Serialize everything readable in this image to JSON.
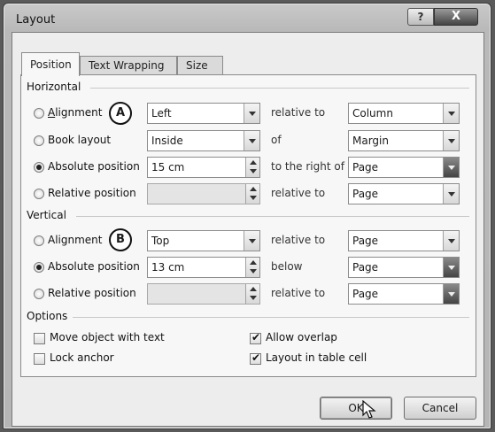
{
  "window": {
    "title": "Layout",
    "help_glyph": "?",
    "close_glyph": "X"
  },
  "tabs": [
    {
      "label": "Position",
      "active": true
    },
    {
      "label": "Text Wrapping",
      "active": false
    },
    {
      "label": "Size",
      "active": false
    }
  ],
  "horizontal": {
    "group_label": "Horizontal",
    "badge": "A",
    "rows": [
      {
        "radio_label": "Alignment",
        "selected": false,
        "value": "Left",
        "relation": "relative to",
        "target": "Column"
      },
      {
        "radio_label": "Book layout",
        "selected": false,
        "value": "Inside",
        "relation": "of",
        "target": "Margin"
      },
      {
        "radio_label": "Absolute position",
        "selected": true,
        "value": "15 cm",
        "relation": "to the right of",
        "target": "Page"
      },
      {
        "radio_label": "Relative position",
        "selected": false,
        "value": "",
        "relation": "relative to",
        "target": "Page"
      }
    ]
  },
  "vertical": {
    "group_label": "Vertical",
    "badge": "B",
    "rows": [
      {
        "radio_label": "Alignment",
        "selected": false,
        "value": "Top",
        "relation": "relative to",
        "target": "Page"
      },
      {
        "radio_label": "Absolute position",
        "selected": true,
        "value": "13 cm",
        "relation": "below",
        "target": "Page"
      },
      {
        "radio_label": "Relative position",
        "selected": false,
        "value": "",
        "relation": "relative to",
        "target": "Page"
      }
    ]
  },
  "options": {
    "group_label": "Options",
    "checkboxes": [
      {
        "label": "Move object with text",
        "checked": false
      },
      {
        "label": "Lock anchor",
        "checked": false
      },
      {
        "label": "Allow overlap",
        "checked": true
      },
      {
        "label": "Layout in table cell",
        "checked": true
      }
    ]
  },
  "buttons": {
    "ok": "OK",
    "cancel": "Cancel"
  }
}
